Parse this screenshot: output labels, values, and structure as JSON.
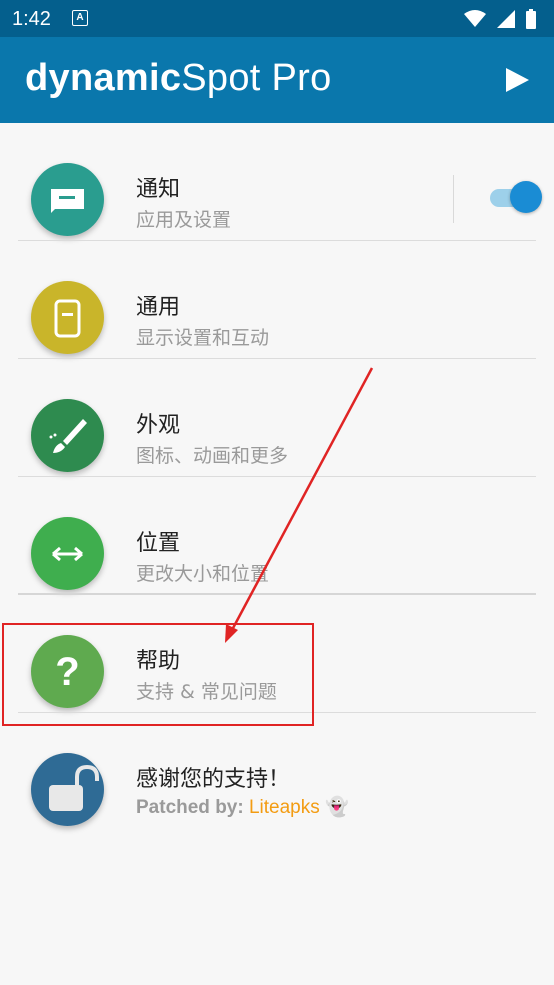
{
  "status_bar": {
    "time": "1:42",
    "notif_icon": "A"
  },
  "app_bar": {
    "title_bold": "dynamic",
    "title_light": "Spot Pro",
    "play_icon": "play-icon"
  },
  "items": [
    {
      "title": "通知",
      "subtitle": "应用及设置",
      "icon": "chat-bubble-icon",
      "color": "#2a9d8f",
      "toggle_on": true
    },
    {
      "title": "通用",
      "subtitle": "显示设置和互动",
      "icon": "phone-icon",
      "color": "#c9b52a"
    },
    {
      "title": "外观",
      "subtitle": "图标、动画和更多",
      "icon": "brush-icon",
      "color": "#2e8b4f"
    },
    {
      "title": "位置",
      "subtitle": "更改大小和位置",
      "icon": "resize-arrows-icon",
      "color": "#3fae4e"
    },
    {
      "title": "帮助",
      "subtitle": "支持 & 常见问题",
      "icon": "question-icon",
      "color": "#5faa4f"
    },
    {
      "title": "感谢您的支持！",
      "subtitle_label": "Patched by:",
      "subtitle_brand": "Liteapks",
      "subtitle_emoji": "👻",
      "icon": "unlock-icon",
      "color": "#2f6b95"
    }
  ],
  "accent_colors": {
    "app_bar": "#0a77ac",
    "status_bar": "#045f8d",
    "highlight": "#e02424"
  }
}
